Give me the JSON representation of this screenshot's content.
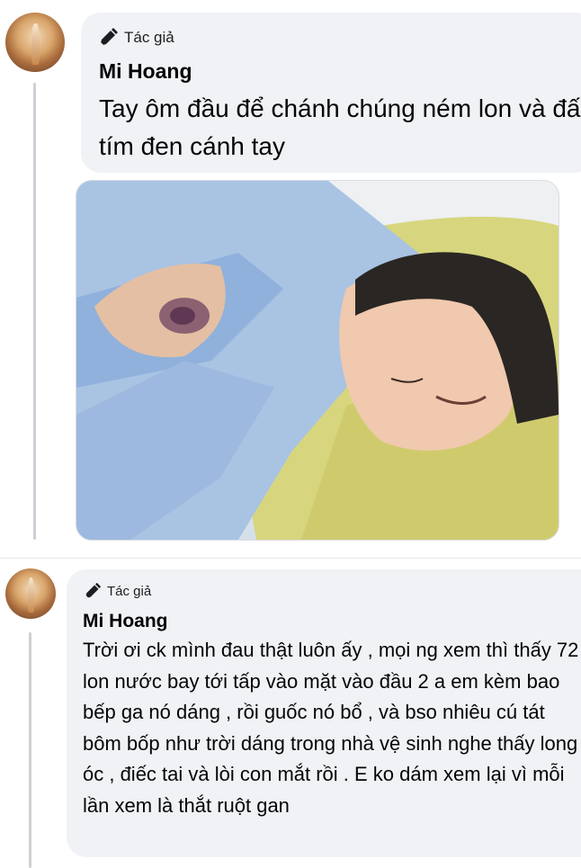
{
  "comments": [
    {
      "badge_label": "Tác giả",
      "author": "Mi Hoang",
      "text": "Tay ôm đầu để chánh chúng ném lon và đấm , tím đen cánh tay",
      "has_photo": true,
      "badge_icon": "pencil-icon"
    },
    {
      "badge_label": "Tác giả",
      "author": "Mi Hoang",
      "text": "Trời ơi ck mình đau thật luôn ấy , mọi ng xem thì thấy 72 lon nước bay tới tấp vào mặt vào đầu 2 a em kèm bao bếp ga nó dáng , rồi guốc nó bổ , và bso nhiêu cú tát bôm bốp như trời dáng trong nhà vệ sinh nghe thấy long óc , điếc tai và lòi con mắt rồi . E ko dám xem lại vì mỗi lần xem là thắt ruột gan",
      "has_photo": false,
      "badge_icon": "pencil-icon"
    }
  ],
  "colors": {
    "bubble": "#f0f2f5",
    "thread_line": "#ced0d4",
    "text": "#050505"
  }
}
